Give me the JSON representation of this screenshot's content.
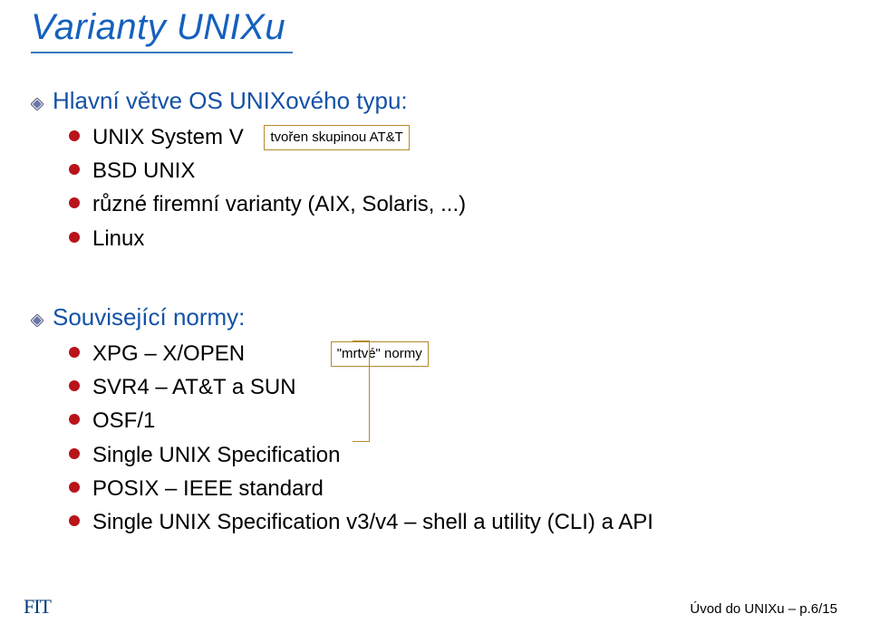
{
  "title": "Varianty UNIXu",
  "section1": {
    "heading": "Hlavní větve OS UNIXového typu:",
    "items": {
      "0": {
        "label": "UNIX System V",
        "note": "tvořen skupinou AT&T"
      },
      "1": {
        "label": "BSD UNIX"
      },
      "2": {
        "label": "různé firemní varianty (AIX, Solaris, ...)"
      },
      "3": {
        "label": "Linux"
      }
    }
  },
  "section2": {
    "heading": "Související normy:",
    "note_dead": "\"mrtvé\" normy",
    "items": {
      "0": {
        "label": "XPG – X/OPEN"
      },
      "1": {
        "label": "SVR4 – AT&T a SUN"
      },
      "2": {
        "label": "OSF/1"
      },
      "3": {
        "label": "Single UNIX Specification"
      },
      "4": {
        "label": "POSIX – IEEE standard"
      },
      "5": {
        "label": "Single UNIX Specification v3/v4 – shell a utility (CLI) a API"
      }
    }
  },
  "footer": {
    "logo": "FIT",
    "right": "Úvod do UNIXu – p.6/15"
  }
}
